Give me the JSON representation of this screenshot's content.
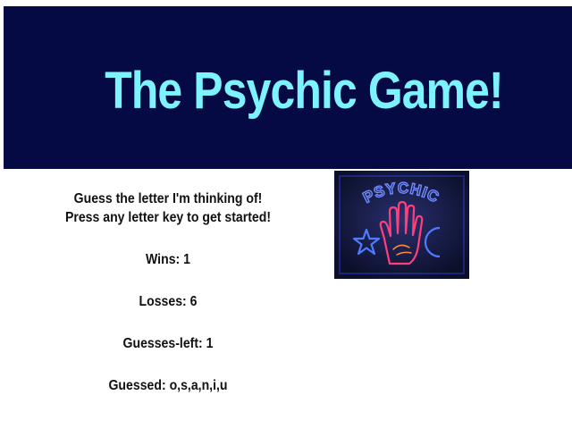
{
  "header": {
    "title": "The Psychic Game!",
    "background": "#050a45",
    "title_color": "#7df3ff"
  },
  "instructions": {
    "line1": "Guess the letter I'm thinking of!",
    "line2": "Press any letter key to get started!"
  },
  "stats": {
    "wins_label": "Wins:",
    "wins": "1",
    "losses_label": "Losses:",
    "losses": "6",
    "guesses_left_label": "Guesses-left:",
    "guesses_left": "1",
    "guessed_label": "Guessed:",
    "guessed": "o,s,a,n,i,u"
  },
  "image": {
    "sign_text": "PSYCHIC",
    "neon_pink": "#ff3e7a",
    "neon_blue": "#3a6bff"
  }
}
